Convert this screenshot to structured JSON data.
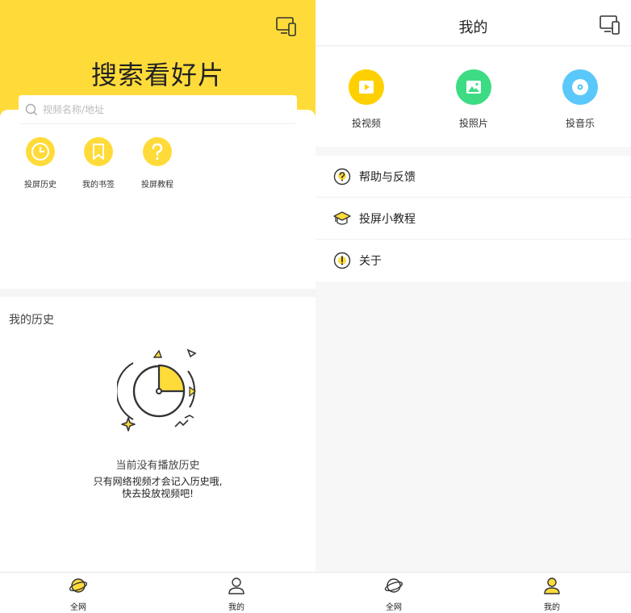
{
  "left": {
    "hero_title": "搜索看好片",
    "search": {
      "placeholder": "视频名称/地址"
    },
    "quick_items": [
      {
        "label": "投屏历史",
        "icon": "clock-icon"
      },
      {
        "label": "我的书签",
        "icon": "bookmark-icon"
      },
      {
        "label": "投屏教程",
        "icon": "question-icon"
      }
    ],
    "history_title": "我的历史",
    "empty_title": "当前没有播放历史",
    "empty_sub_line1": "只有网络视频才会记入历史哦,",
    "empty_sub_line2": "快去投放视频吧!",
    "nav": [
      {
        "label": "全网",
        "icon": "planet-icon"
      },
      {
        "label": "我的",
        "icon": "user-icon"
      }
    ]
  },
  "right": {
    "title": "我的",
    "actions": [
      {
        "label": "投视频",
        "icon": "video-icon",
        "color": "#ffd000"
      },
      {
        "label": "投照片",
        "icon": "photo-icon",
        "color": "#3ddc84"
      },
      {
        "label": "投音乐",
        "icon": "disc-icon",
        "color": "#5ac8fa"
      }
    ],
    "menu": [
      {
        "label": "帮助与反馈",
        "icon": "help-icon"
      },
      {
        "label": "投屏小教程",
        "icon": "graduation-cap-icon"
      },
      {
        "label": "关于",
        "icon": "info-icon"
      }
    ],
    "nav": [
      {
        "label": "全网",
        "icon": "planet-icon"
      },
      {
        "label": "我的",
        "icon": "user-icon"
      }
    ]
  },
  "colors": {
    "accent": "#ffdb3a",
    "background": "#f7f7f7"
  }
}
